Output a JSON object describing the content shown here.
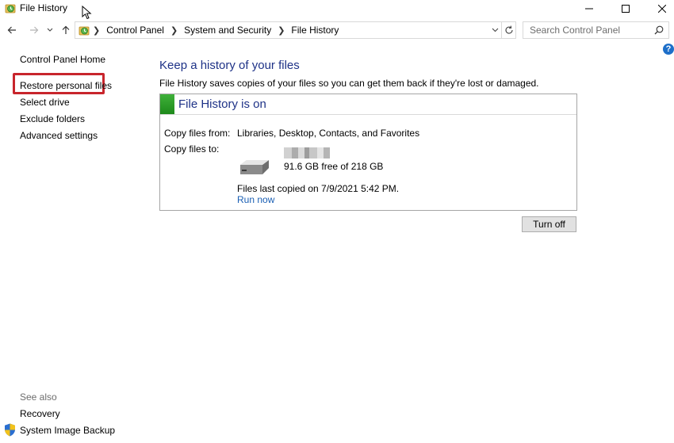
{
  "window": {
    "title": "File History",
    "controls": {
      "minimize_icon": "minimize-icon",
      "maximize_icon": "maximize-icon",
      "close_icon": "close-icon"
    }
  },
  "navigation": {
    "breadcrumbs": [
      "Control Panel",
      "System and Security",
      "File History"
    ],
    "search_placeholder": "Search Control Panel"
  },
  "left_pane": {
    "links": [
      "Control Panel Home",
      "Restore personal files",
      "Select drive",
      "Exclude folders",
      "Advanced settings"
    ],
    "highlighted_link": "Restore personal files",
    "see_also_heading": "See also",
    "see_also_links": [
      "Recovery",
      "System Image Backup"
    ]
  },
  "main": {
    "heading": "Keep a history of your files",
    "description": "File History saves copies of your files so you can get them back if they're lost or damaged.",
    "status_title": "File History is on",
    "copy_from_label": "Copy files from:",
    "copy_from_value": "Libraries, Desktop, Contacts, and Favorites",
    "copy_to_label": "Copy files to:",
    "drive_free": "91.6 GB free of 218 GB",
    "last_copied": "Files last copied on 7/9/2021 5:42 PM.",
    "run_now": "Run now",
    "turn_off_button": "Turn off"
  },
  "colors": {
    "heading_blue": "#1e3287",
    "link_blue": "#1a5fb4",
    "status_green": "#2ea02a",
    "highlight_red": "#c8252c"
  }
}
